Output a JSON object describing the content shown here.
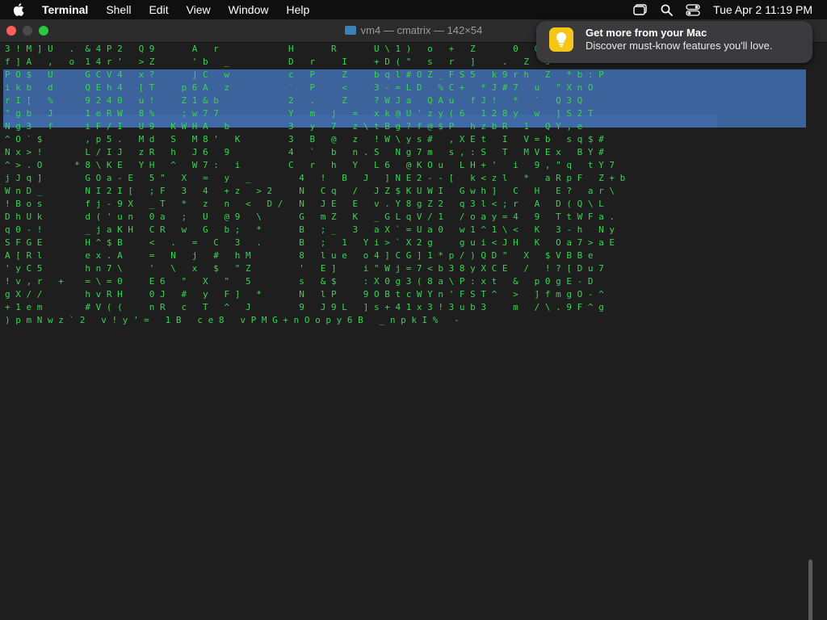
{
  "menubar": {
    "app_name": "Terminal",
    "items": [
      "Shell",
      "Edit",
      "View",
      "Window",
      "Help"
    ],
    "clock": "Tue Apr 2  11:19 PM"
  },
  "window": {
    "title": "vm4 — cmatrix — 142×54"
  },
  "notification": {
    "title": "Get more from your Mac",
    "body": "Discover must-know features you'll love."
  },
  "colors": {
    "matrix_green": "#39d353",
    "matrix_white": "#e6e6e6",
    "selection": "#3f6aa8",
    "close": "#ff5f57",
    "minimize_disabled": "#4a4a4a",
    "zoom": "#28c840",
    "notification_icon": "#f5c518"
  },
  "terminal": {
    "matrix_lines": [
      "3 ! M ] U   .  & 4 P 2   Q 9       A   r             H       R       U \\ 1 )   o   +   Z       0   O",
      "f ] A   ,   o  1 4 r '   > Z       ' b   _           D   r     I     + D ( \"   s   r   ]     .   Z   5",
      "P O $   U      G C V 4   x ?       j C   w           c   P     Z     b q l # O Z _ F S 5   k 9 r h   Z   * b : P",
      "i k b   d      Q E h 4   [ T     p 6 A   z           `   P     <     3 - = L D   % C +   * J # 7   u   \" X n O",
      "r I [   %      9 2 4 0   u !     Z 1 & b             2   .     Z     ? W J a   Q A u   f J !   *   `   Q 3 Q",
      "\" g b   J      1 e R W   8 %     ; w 7 7             Y   m   j   =   x k @ U ' z y ( 6   1 2 8 y   w   ] S 2 T",
      "N g 3   f      i F / I   U 9   K W H A   b           3   y   7   z \\ t B g ? f @ $ P   h z b R   1   Q Y , e",
      "^ O ` $        , p 5 .   M d   S   M 8 '   K         3   B   @   z   ! W \\ y s #   , X E t   I   V = b   s q $ #",
      "N x > !        L / I J   z R   h   J 6   9           4   `   b   n . S   N g 7 m   s , : S   T   M V E x   B Y #",
      "^ > . O      * 8 \\ K E   Y H   ^   W 7 :   i         C   r   h   Y   L 6   @ K O u   L H + '   i   9 , \" q   t Y 7",
      "j J q ]        G O a - E   5 \"   X   =   y   _         4   !   B   J   ] N E 2 - - [   k < z l   *   a R p F   Z + b",
      "W n D _        N I 2 I [   ; F   3   4   + z   > 2     N   C q   /   J Z $ K U W I   G w h ]   C   H   E ?   a r \\",
      "! B o s        f j - 9 X   _ T   *   z   n   <   D /   N   J E   E   v . Y 8 g Z 2   q 3 l < ; r   A   D ( Q \\ L",
      "D h U k        d ( ' u n   0 a   ;   U   @ 9   \\       G   m Z   K   _ G L q V / 1   / o a y = 4   9   T t W F a .",
      "q 0 - !        _ j a K H   C R   w   G   b ;   *       B   ; _   3   a X ` = U a 0   w 1 ^ 1 \\ <   K   3 - h   N y",
      "S F G E        H ^ $ B     <   .   =   C   3   .       B   ;   1   Y i > ` X 2 g     g u i < J H   K   O a 7 > a E",
      "A [ R l        e x . A     =   N   j   #   h M         8   l u e   o 4 ] C G ] 1 * p / ) Q D \"   X   $ V B B e",
      "' y C 5        h n 7 \\     '   \\   x   $   \" Z         '   E ]     i \" W j = 7 < b 3 8 y X C E   /   ! ? [ D u 7",
      "! v , r   +    = \\ = 0     E 6   \"   X   \"   5         s   & $     : X 0 g 3 ( 8 a \\ P : x t   &   p 0 g E - D",
      "g X / /        h v R H     0 J   #   y   F ]   *       N   l P     9 O B t c W Y n ' F S T ^   >   ] f m g O - ^",
      "+ 1 e m        # V ( (     n R   c   T   ^   J         9   J 9 L   ] s + 4 1 x 3 ! 3 u b 3     m   / \\ . 9 F ^ g",
      ") p m N w z ` 2   v ! y ' =   1 B   c e 8   v P M G + n O o p y 6 B   _ n p k I %   -"
    ]
  }
}
